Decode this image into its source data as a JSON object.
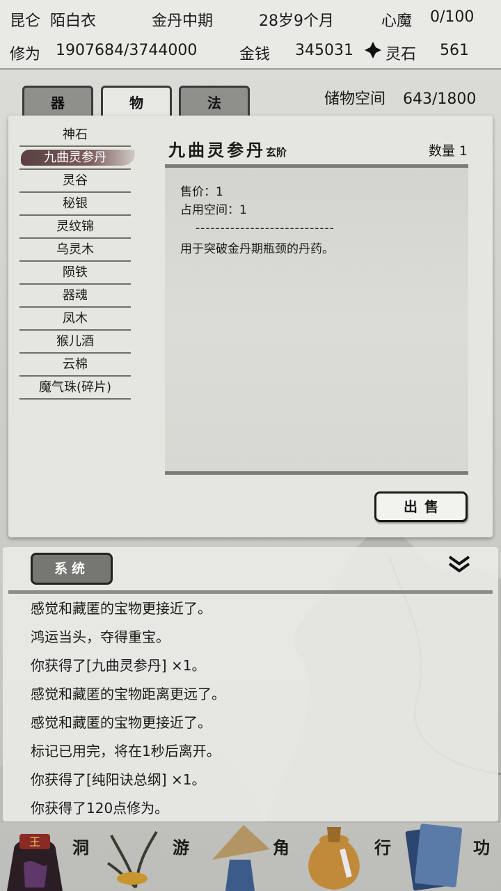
{
  "status": {
    "location": "昆仑",
    "name": "陌白衣",
    "realm": "金丹中期",
    "age": "28岁9个月",
    "demon_label": "心魔",
    "demon_value": "0/100",
    "cultivation_label": "修为",
    "cultivation_value": "1907684/3744000",
    "money_label": "金钱",
    "money_value": "345031",
    "spirit_stone_label": "灵石",
    "spirit_stone_value": "561"
  },
  "tabs": [
    {
      "label": "器"
    },
    {
      "label": "物"
    },
    {
      "label": "法"
    }
  ],
  "storage": {
    "label": "储物空间",
    "value": "643/1800"
  },
  "items": [
    {
      "label": "神石"
    },
    {
      "label": "九曲灵参丹"
    },
    {
      "label": "灵谷"
    },
    {
      "label": "秘银"
    },
    {
      "label": "灵纹锦"
    },
    {
      "label": "乌灵木"
    },
    {
      "label": "陨铁"
    },
    {
      "label": "器魂"
    },
    {
      "label": "凤木"
    },
    {
      "label": "猴儿酒"
    },
    {
      "label": "云棉"
    },
    {
      "label": "魔气珠(碎片)"
    }
  ],
  "detail": {
    "name": "九曲灵参丹",
    "grade": "玄阶",
    "quantity": "数量 1",
    "price": "售价：1",
    "space": "占用空间：1",
    "separator": "----------------------------",
    "description": "用于突破金丹期瓶颈的丹药。",
    "sell_label": "出售"
  },
  "log": {
    "tab_label": "系统",
    "lines": [
      "感觉和藏匿的宝物更接近了。",
      "鸿运当头，夺得重宝。",
      "你获得了[九曲灵参丹] ×1。",
      "感觉和藏匿的宝物距离更远了。",
      "感觉和藏匿的宝物更接近了。",
      "标记已用完，将在1秒后离开。",
      "你获得了[纯阳诀总纲] ×1。",
      "你获得了120点修为。"
    ]
  },
  "nav": [
    {
      "label": "洞",
      "icon": "king-icon"
    },
    {
      "label": "游",
      "icon": "herb-icon"
    },
    {
      "label": "角",
      "icon": "bamboo-hat-icon"
    },
    {
      "label": "行",
      "icon": "bag-icon"
    },
    {
      "label": "功",
      "icon": "book-icon"
    }
  ],
  "colors": {
    "selected_item": "#6a4c4e",
    "panel": "#e6e6e0",
    "tab_inactive": "#8f8f8b"
  }
}
